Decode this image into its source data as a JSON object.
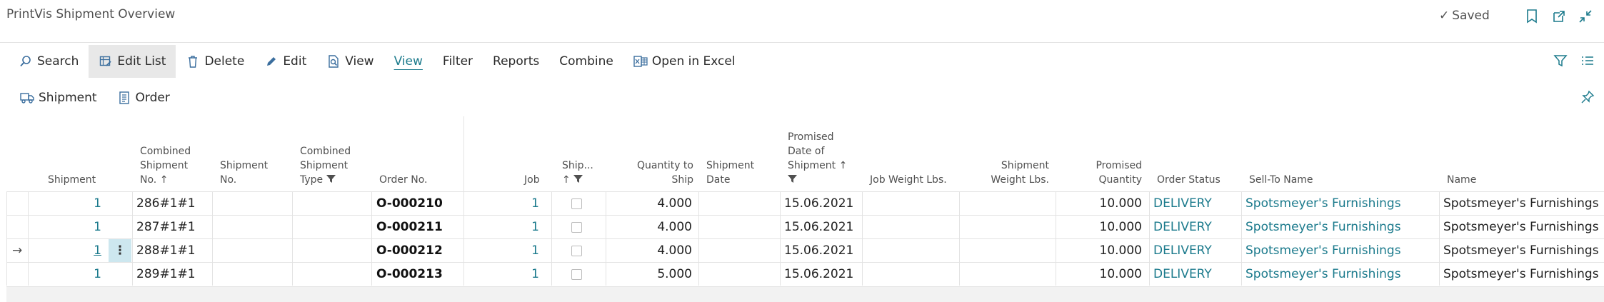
{
  "window": {
    "title": "PrintVis Shipment Overview",
    "saved_label": "Saved"
  },
  "actions": [
    {
      "label": "Search",
      "icon": "search-icon"
    },
    {
      "label": "Edit List",
      "icon": "edit-list-icon"
    },
    {
      "label": "Delete",
      "icon": "trash-icon"
    },
    {
      "label": "Edit",
      "icon": "pencil-icon"
    },
    {
      "label": "View",
      "icon": "view-icon"
    },
    {
      "label": "View",
      "icon": ""
    },
    {
      "label": "Filter",
      "icon": ""
    },
    {
      "label": "Reports",
      "icon": ""
    },
    {
      "label": "Combine",
      "icon": ""
    },
    {
      "label": "Open in Excel",
      "icon": "excel-icon"
    }
  ],
  "actions2": [
    {
      "label": "Shipment",
      "icon": "truck-icon"
    },
    {
      "label": "Order",
      "icon": "document-icon"
    }
  ],
  "columns": [
    "Shipment",
    "Combined Shipment No. ↑",
    "Shipment No.",
    "Combined Shipment Type",
    "Order No.",
    "Job",
    "Ship... ↑",
    "Quantity to Ship",
    "Shipment Date",
    "Promised Date of Shipment ↑",
    "Job Weight Lbs.",
    "Shipment Weight Lbs.",
    "Promised Quantity",
    "Order Status",
    "Sell-To Name",
    "Name"
  ],
  "header_lines": {
    "c0": [
      "Shipment"
    ],
    "c1": [
      "Combined",
      "Shipment",
      "No. ↑"
    ],
    "c2": [
      "Shipment",
      "No."
    ],
    "c3": [
      "Combined",
      "Shipment",
      "Type"
    ],
    "c4": [
      "Order No."
    ],
    "c5": [
      "Job"
    ],
    "c6": [
      "Ship...",
      "↑"
    ],
    "c7": [
      "Quantity to",
      "Ship"
    ],
    "c8": [
      "Shipment",
      "Date"
    ],
    "c9": [
      "Promised",
      "Date of",
      "Shipment ↑"
    ],
    "c10": [
      "Job Weight Lbs."
    ],
    "c11": [
      "Shipment",
      "Weight Lbs."
    ],
    "c12": [
      "Promised",
      "Quantity"
    ],
    "c13": [
      "Order Status"
    ],
    "c14": [
      "Sell-To Name"
    ],
    "c15": [
      "Name"
    ]
  },
  "rows": [
    {
      "shipment": "1",
      "combined_no": "286#1#1",
      "shipment_no": "",
      "combined_type": "",
      "order_no": "O-000210",
      "job": "1",
      "shipped": false,
      "qty_to_ship": "4.000",
      "shipment_date": "",
      "promised_date": "15.06.2021",
      "job_weight": "",
      "shipment_weight": "",
      "promised_qty": "10.000",
      "order_status": "DELIVERY",
      "sell_to": "Spotsmeyer's Furnishings",
      "name": "Spotsmeyer's Furnishings"
    },
    {
      "shipment": "1",
      "combined_no": "287#1#1",
      "shipment_no": "",
      "combined_type": "",
      "order_no": "O-000211",
      "job": "1",
      "shipped": false,
      "qty_to_ship": "4.000",
      "shipment_date": "",
      "promised_date": "15.06.2021",
      "job_weight": "",
      "shipment_weight": "",
      "promised_qty": "10.000",
      "order_status": "DELIVERY",
      "sell_to": "Spotsmeyer's Furnishings",
      "name": "Spotsmeyer's Furnishings"
    },
    {
      "shipment": "1",
      "combined_no": "288#1#1",
      "shipment_no": "",
      "combined_type": "",
      "order_no": "O-000212",
      "job": "1",
      "shipped": false,
      "qty_to_ship": "4.000",
      "shipment_date": "",
      "promised_date": "15.06.2021",
      "job_weight": "",
      "shipment_weight": "",
      "promised_qty": "10.000",
      "order_status": "DELIVERY",
      "sell_to": "Spotsmeyer's Furnishings",
      "name": "Spotsmeyer's Furnishings"
    },
    {
      "shipment": "1",
      "combined_no": "289#1#1",
      "shipment_no": "",
      "combined_type": "",
      "order_no": "O-000213",
      "job": "1",
      "shipped": false,
      "qty_to_ship": "5.000",
      "shipment_date": "",
      "promised_date": "15.06.2021",
      "job_weight": "",
      "shipment_weight": "",
      "promised_qty": "10.000",
      "order_status": "DELIVERY",
      "sell_to": "Spotsmeyer's Furnishings",
      "name": "Spotsmeyer's Furnishings"
    }
  ],
  "selected_row": 2,
  "colors": {
    "accent": "#1b7a8c",
    "link": "#1b7a8c",
    "selected_cell": "#cde7ef"
  }
}
